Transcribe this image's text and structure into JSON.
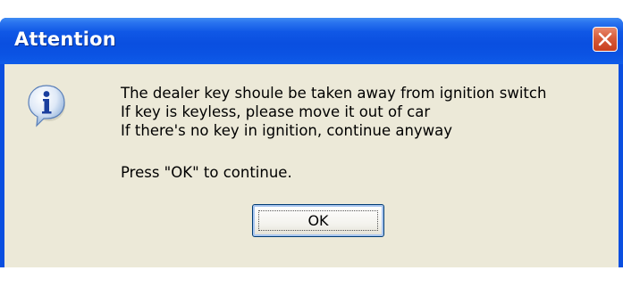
{
  "dialog": {
    "title": "Attention",
    "close_icon": "close-icon",
    "info_icon": "info-icon",
    "message_lines": [
      "The dealer key shoule be taken away from ignition switch",
      "If key is keyless, please move it out of car",
      "If there's no key in ignition, continue anyway"
    ],
    "prompt": "Press \"OK\" to continue.",
    "ok_label": "OK"
  },
  "colors": {
    "titlebar": "#0a4fe0",
    "client": "#ece9d8",
    "close_button": "#d75b3a"
  }
}
